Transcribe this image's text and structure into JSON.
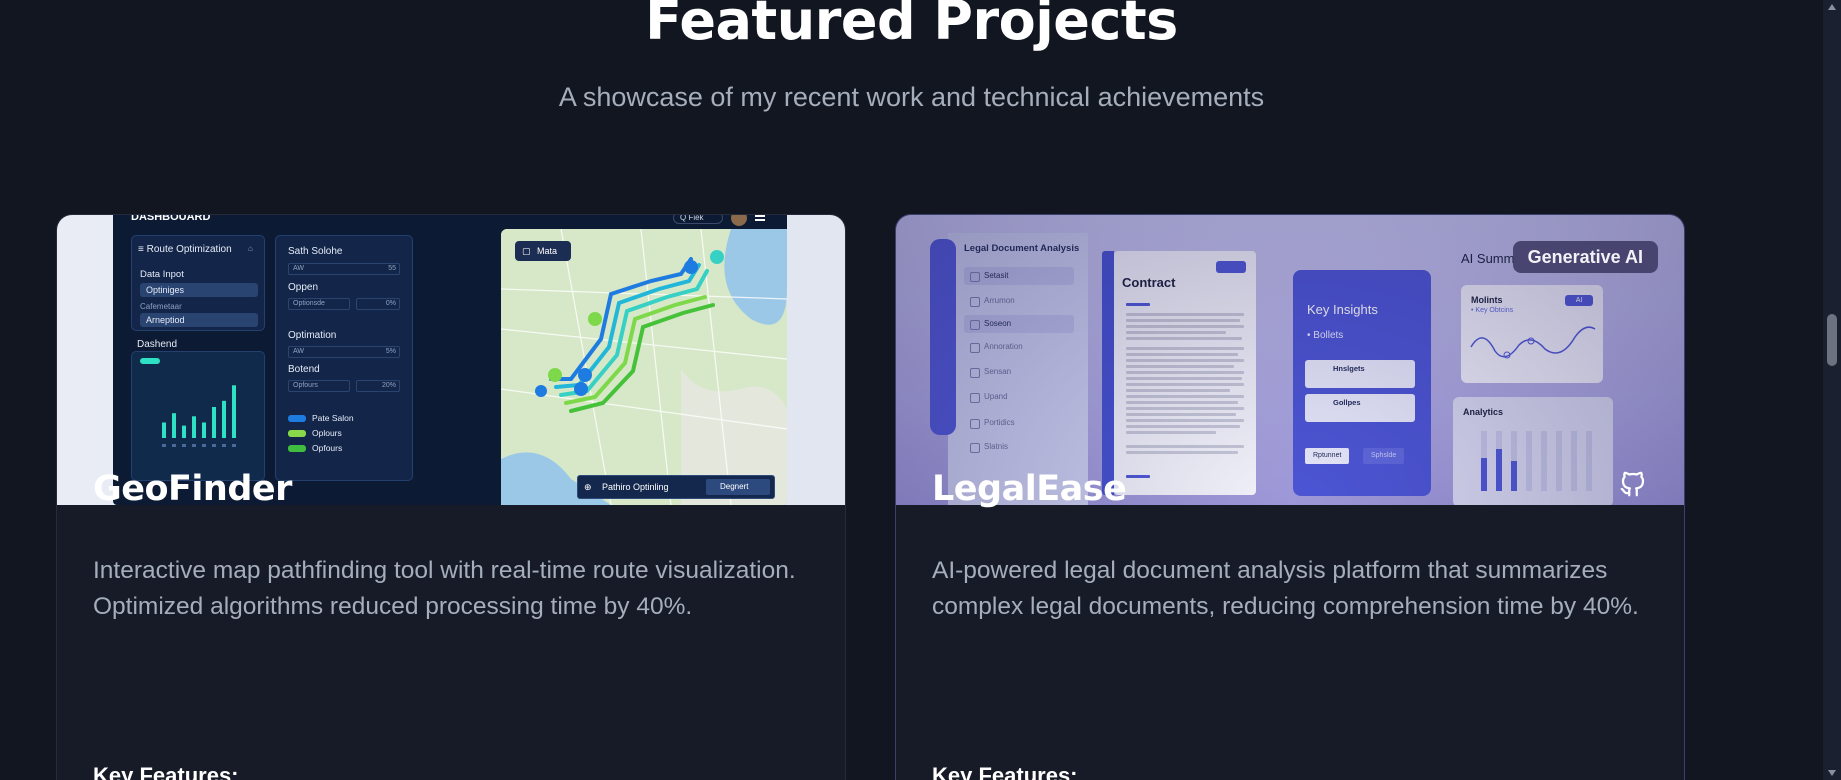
{
  "section": {
    "title": "Featured Projects",
    "subtitle": "A showcase of my recent work and technical achievements"
  },
  "projects": [
    {
      "title": "GeoFinder",
      "description": "Interactive map pathfinding tool with real-time route visualization. Optimized algorithms reduced processing time by 40%.",
      "features_heading": "Key Features:",
      "screenshot": {
        "topbar_brand": "DASHBOUARD",
        "topbar_search": "Q Fiek",
        "panel_title": "Route Optimization",
        "data_input_label": "Data Inpot",
        "data_input_value": "Optiniges",
        "secondary_label": "Cafemetaar",
        "secondary_value": "Arneptiod",
        "dashboard_label": "Dashend",
        "sath_label": "Sath Solohe",
        "sath_field": "AW",
        "sath_value": "55",
        "oppen_label": "Oppen",
        "oppen_field": "Optionsde",
        "oppen_value": "0%",
        "optim_label": "Optimation",
        "optim_field": "AW",
        "optim_value": "5%",
        "botend_label": "Botend",
        "botend_field": "Opfours",
        "botend_value": "20%",
        "legend": [
          "Pate Salon",
          "Oplours",
          "Opfours"
        ],
        "map_button": "Mata",
        "bottom_bar_label": "Pathiro Optinling",
        "bottom_bar_dropdown": "Degnert",
        "bars": [
          0.25,
          0.4,
          0.2,
          0.35,
          0.25,
          0.5,
          0.6,
          0.85
        ]
      }
    },
    {
      "title": "LegalEase",
      "description": "AI-powered legal document analysis platform that summarizes complex legal documents, reducing comprehension time by 40%.",
      "features_heading": "Key Features:",
      "badge": "Generative AI",
      "github_icon": "github-icon",
      "screenshot": {
        "sidebar_title": "Legal Document Analysis",
        "nav": [
          "Setasit",
          "Arrumon",
          "Soseon",
          "Annoration",
          "Sensan",
          "Upand",
          "Portidics",
          "Slatnis"
        ],
        "doc_title": "Contract",
        "insights_title": "Key Insights",
        "insights_bullet": "Bollets",
        "insight_cards": [
          "Hnslgets",
          "Gollpes"
        ],
        "buttons": [
          "Rptunnet",
          "Sphslde"
        ],
        "ai_summary": "AI Summ",
        "molints": "Molints",
        "molints_sub": "Key Obtcins",
        "ai_pill": "AI",
        "analytics": "Analytics"
      }
    }
  ]
}
